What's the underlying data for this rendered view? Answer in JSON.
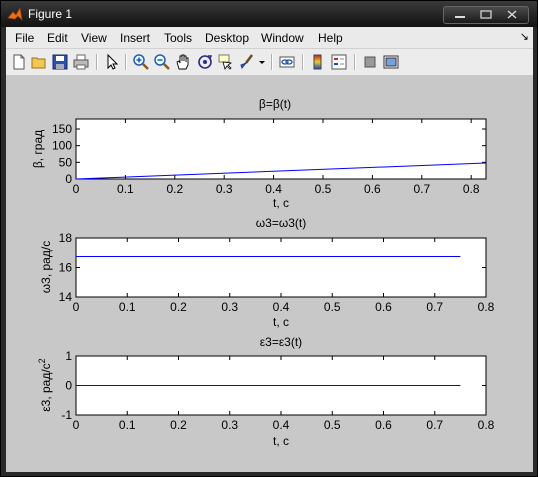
{
  "window": {
    "title": "Figure 1"
  },
  "menu": {
    "items": [
      "File",
      "Edit",
      "View",
      "Insert",
      "Tools",
      "Desktop",
      "Window",
      "Help"
    ],
    "arrow": "↘"
  },
  "toolbar": {
    "icons": [
      "new-figure-icon",
      "open-file-icon",
      "save-icon",
      "print-icon",
      "edit-plot-arrow-icon",
      "zoom-in-icon",
      "zoom-out-icon",
      "pan-hand-icon",
      "rotate-3d-icon",
      "data-cursor-icon",
      "brush-icon",
      "brush-dropdown-icon",
      "link-plot-icon",
      "insert-colorbar-icon",
      "insert-legend-icon",
      "hide-plot-tools-icon",
      "show-plot-tools-icon"
    ]
  },
  "chart_data": [
    {
      "type": "line",
      "title": "β=β(t)",
      "xlabel": "t, c",
      "ylabel": "β, град",
      "xlim": [
        0,
        0.83
      ],
      "ylim": [
        0,
        180
      ],
      "xticks": [
        "0",
        "0.1",
        "0.2",
        "0.3",
        "0.4",
        "0.5",
        "0.6",
        "0.7",
        "0.8"
      ],
      "yticks": [
        "0",
        "50",
        "100",
        "150"
      ],
      "series": [
        {
          "x": [
            0,
            0.83
          ],
          "y": [
            0,
            48
          ]
        }
      ],
      "color": "#0000ff"
    },
    {
      "type": "line",
      "title": "ω3=ω3(t)",
      "xlabel": "t, c",
      "ylabel": "ω3, рад/с",
      "xlim": [
        0,
        0.8
      ],
      "ylim": [
        14,
        18
      ],
      "xticks": [
        "0",
        "0.1",
        "0.2",
        "0.3",
        "0.4",
        "0.5",
        "0.6",
        "0.7",
        "0.8"
      ],
      "yticks": [
        "14",
        "16",
        "18"
      ],
      "series": [
        {
          "x": [
            0,
            0.75
          ],
          "y": [
            16.75,
            16.75
          ]
        }
      ],
      "color": "#0000ff"
    },
    {
      "type": "line",
      "title": "ε3=ε3(t)",
      "xlabel": "t, c",
      "ylabel": "ε3, рад/с",
      "ylabel_sup": "2",
      "xlim": [
        0,
        0.8
      ],
      "ylim": [
        -1,
        1
      ],
      "xticks": [
        "0",
        "0.1",
        "0.2",
        "0.3",
        "0.4",
        "0.5",
        "0.6",
        "0.7",
        "0.8"
      ],
      "yticks": [
        "-1",
        "0",
        "1"
      ],
      "series": [
        {
          "x": [
            0,
            0.75
          ],
          "y": [
            0,
            0
          ]
        }
      ],
      "color": "#0000ff"
    }
  ]
}
